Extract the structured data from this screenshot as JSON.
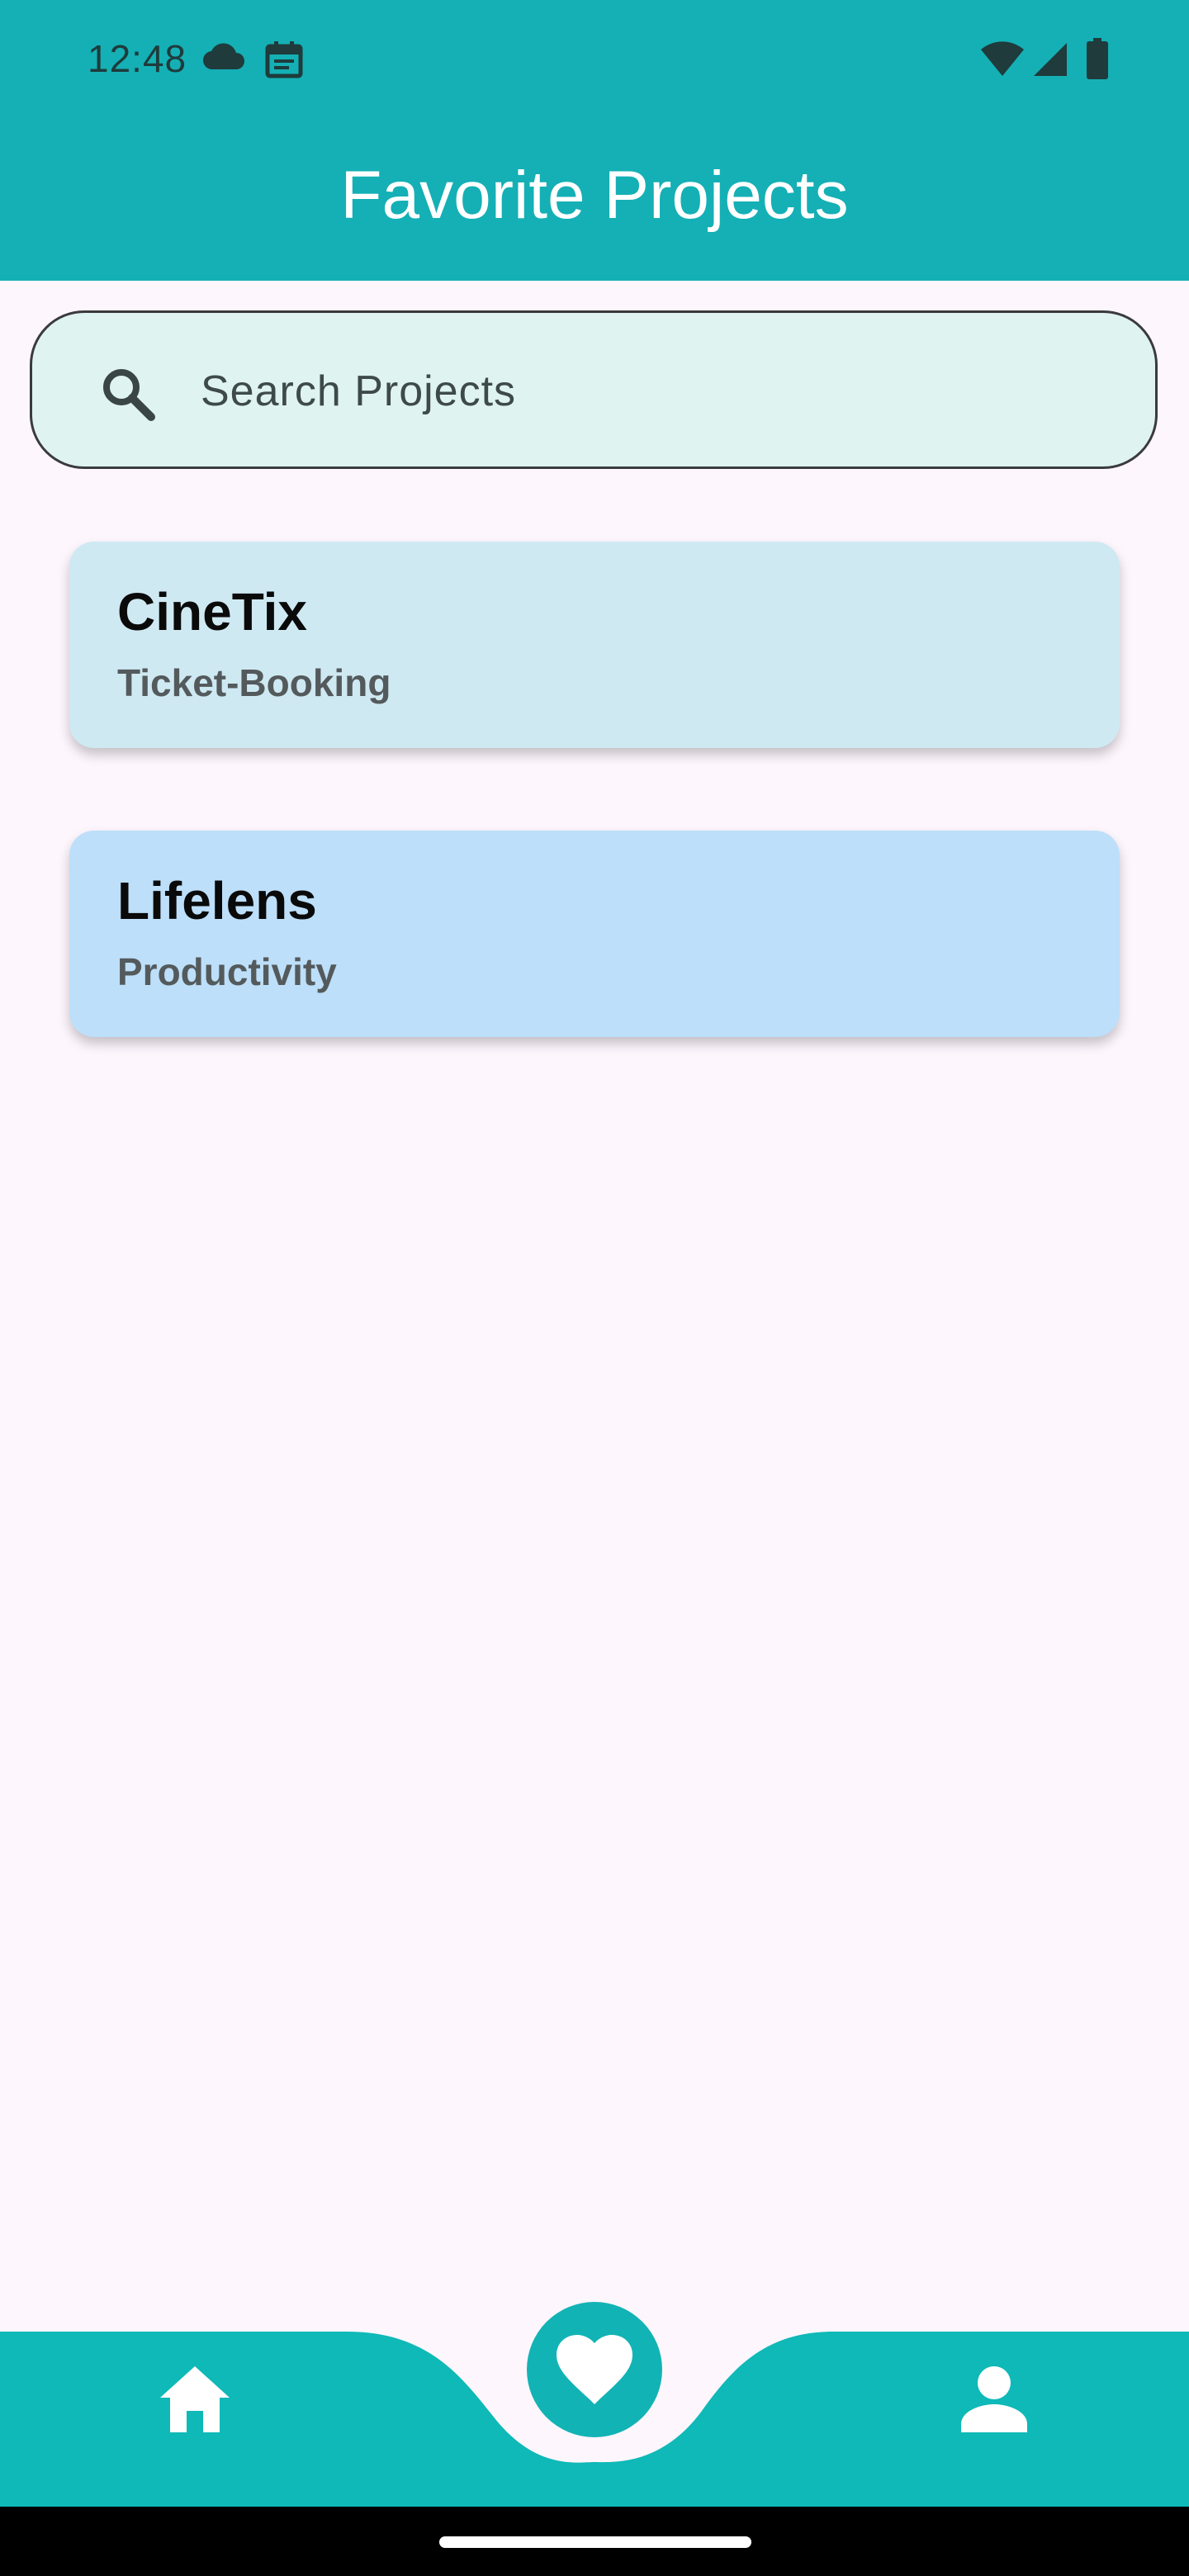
{
  "status_bar": {
    "time": "12:48",
    "left_icons": [
      "cloud-icon",
      "calendar-icon"
    ],
    "right_icons": [
      "wifi-icon",
      "cellular-signal-icon",
      "battery-icon"
    ]
  },
  "app_bar": {
    "title": "Favorite Projects"
  },
  "search": {
    "placeholder": "Search Projects",
    "value": "",
    "icon": "search-icon"
  },
  "projects": [
    {
      "title": "CineTix",
      "category": "Ticket-Booking",
      "color": "#CFE9F3"
    },
    {
      "title": "Lifelens",
      "category": "Productivity",
      "color": "#BDDFF9"
    }
  ],
  "bottom_nav": {
    "items": [
      {
        "icon": "home-icon",
        "selected": false
      },
      {
        "icon": "heart-icon",
        "selected": true
      },
      {
        "icon": "person-icon",
        "selected": false
      }
    ],
    "color": "#0EB9B7"
  },
  "colors": {
    "primary": "#14B0B5",
    "background": "#FDF6FD",
    "search_fill": "#DFF3F1"
  }
}
